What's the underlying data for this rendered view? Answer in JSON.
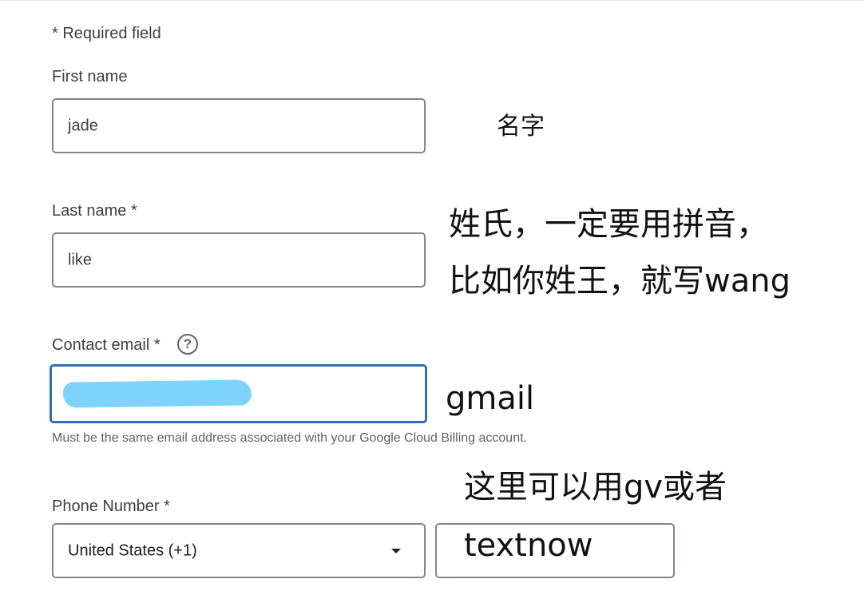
{
  "form": {
    "required_note": "* Required field",
    "first_name": {
      "label": "First name",
      "value": "jade"
    },
    "last_name": {
      "label": "Last name *",
      "value": "like"
    },
    "contact_email": {
      "label": "Contact email *",
      "help_icon": "?",
      "value_redacted": true,
      "hint": "Must be the same email address associated with your Google Cloud Billing account."
    },
    "phone_number": {
      "label": "Phone Number *",
      "country_value": "United States (+1)",
      "number_value": ""
    }
  },
  "annotations": {
    "first_name_note": "名字",
    "last_name_note_line1": "姓氏，一定要用拼音，",
    "last_name_note_line2": "比如你姓王，就写wang",
    "email_note": "gmail",
    "phone_note_line1": "这里可以用gv或者",
    "phone_note_line2": "textnow"
  },
  "colors": {
    "field_border": "#80868b",
    "focused_border": "#2f6fb3",
    "redaction": "#7ed3fb",
    "label_text": "#3c4043",
    "hint_text": "#5f6368"
  },
  "icons": {
    "help": "help-circle-icon",
    "dropdown": "caret-down-icon"
  }
}
